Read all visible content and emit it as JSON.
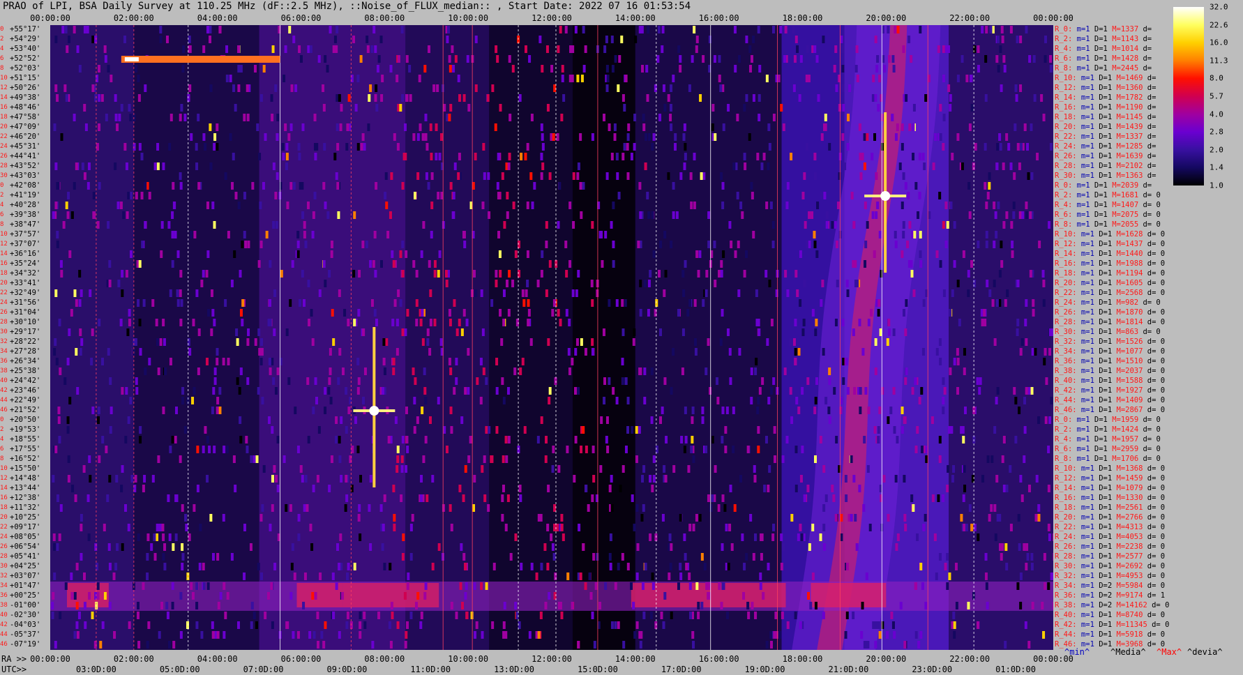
{
  "title": "PRAO of LPI, BSA Daily Survey at 110.25 MHz (dF::2.5 MHz), ::Noise_of_FLUX_median:: , Start Date: 2022 07 16 01:53:54",
  "chart_data": {
    "type": "heatmap",
    "title": "PRAO of LPI, BSA Daily Survey at 110.25 MHz (dF::2.5 MHz), ::Noise_of_FLUX_median:: , Start Date: 2022 07 16 01:53:54",
    "x_ra_ticks": [
      "00:00:00",
      "02:00:00",
      "04:00:00",
      "06:00:00",
      "08:00:00",
      "10:00:00",
      "12:00:00",
      "14:00:00",
      "16:00:00",
      "18:00:00",
      "20:00:00",
      "22:00:00",
      "00:00:00"
    ],
    "x_utc_ticks": [
      "03:0D:00",
      "05:0D:00",
      "07:0D:00",
      "09:0D:00",
      "11:0D:00",
      "13:0D:00",
      "15:0D:00",
      "17:0D:00",
      "19:0D:00",
      "21:0D:00",
      "23:0D:00",
      "01:0D:00"
    ],
    "dec_labels": [
      "+55°17'",
      "+54°29'",
      "+53°40'",
      "+52°52'",
      "+52°03'",
      "+51°15'",
      "+50°26'",
      "+49°38'",
      "+48°46'",
      "+47°58'",
      "+47°09'",
      "+46°20'",
      "+45°31'",
      "+44°41'",
      "+43°52'",
      "+43°03'",
      "+42°08'",
      "+41°19'",
      "+40°28'",
      "+39°38'",
      "+38°47'",
      "+37°57'",
      "+37°07'",
      "+36°16'",
      "+35°24'",
      "+34°32'",
      "+33°41'",
      "+32°49'",
      "+31°56'",
      "+31°04'",
      "+30°10'",
      "+29°17'",
      "+28°22'",
      "+27°28'",
      "+26°34'",
      "+25°38'",
      "+24°42'",
      "+23°46'",
      "+22°49'",
      "+21°52'",
      "+20°50'",
      "+19°53'",
      "+18°55'",
      "+17°55'",
      "+16°52'",
      "+15°50'",
      "+14°48'",
      "+13°44'",
      "+12°38'",
      "+11°32'",
      "+10°25'",
      "+09°17'",
      "+08°05'",
      "+06°54'",
      "+05°41'",
      "+04°25'",
      "+03°07'",
      "+01°47'",
      "+00°25'",
      "-01°00'",
      "-02°30'",
      "-04°03'",
      "-05°37'",
      "-07°19'"
    ],
    "row_numbers": [
      "0",
      "2",
      "4",
      "6",
      "8",
      "10",
      "12",
      "14",
      "16",
      "18",
      "20",
      "22",
      "24",
      "26",
      "28",
      "30",
      "0",
      "2",
      "4",
      "6",
      "8",
      "10",
      "12",
      "14",
      "16",
      "18",
      "20",
      "22",
      "24",
      "26",
      "28",
      "30",
      "32",
      "34",
      "36",
      "38",
      "40",
      "42",
      "44",
      "46",
      "0",
      "2",
      "4",
      "6",
      "8",
      "10",
      "12",
      "14",
      "16",
      "18",
      "20",
      "22",
      "24",
      "26",
      "28",
      "30",
      "32",
      "34",
      "36",
      "38",
      "40",
      "42",
      "44",
      "46"
    ],
    "row_stats": [
      {
        "r": "R_0:",
        "m": "1",
        "D": "1",
        "M": "1337",
        "d": ""
      },
      {
        "r": "R_2:",
        "m": "1",
        "D": "1",
        "M": "1143",
        "d": ""
      },
      {
        "r": "R_4:",
        "m": "1",
        "D": "1",
        "M": "1014",
        "d": ""
      },
      {
        "r": "R_6:",
        "m": "1",
        "D": "1",
        "M": "1428",
        "d": ""
      },
      {
        "r": "R_8:",
        "m": "1",
        "D": "1",
        "M": "2445",
        "d": ""
      },
      {
        "r": "R_10:",
        "m": "1",
        "D": "1",
        "M": "1469",
        "d": ""
      },
      {
        "r": "R_12:",
        "m": "1",
        "D": "1",
        "M": "1360",
        "d": ""
      },
      {
        "r": "R_14:",
        "m": "1",
        "D": "1",
        "M": "1782",
        "d": ""
      },
      {
        "r": "R_16:",
        "m": "1",
        "D": "1",
        "M": "1190",
        "d": ""
      },
      {
        "r": "R_18:",
        "m": "1",
        "D": "1",
        "M": "1145",
        "d": ""
      },
      {
        "r": "R_20:",
        "m": "1",
        "D": "1",
        "M": "1439",
        "d": ""
      },
      {
        "r": "R_22:",
        "m": "1",
        "D": "1",
        "M": "1337",
        "d": ""
      },
      {
        "r": "R_24:",
        "m": "1",
        "D": "1",
        "M": "1285",
        "d": ""
      },
      {
        "r": "R_26:",
        "m": "1",
        "D": "1",
        "M": "1639",
        "d": ""
      },
      {
        "r": "R_28:",
        "m": "1",
        "D": "1",
        "M": "2102",
        "d": ""
      },
      {
        "r": "R_30:",
        "m": "1",
        "D": "1",
        "M": "1363",
        "d": ""
      },
      {
        "r": "R_0:",
        "m": "1",
        "D": "1",
        "M": "2039",
        "d": ""
      },
      {
        "r": "R_2:",
        "m": "1",
        "D": "1",
        "M": "1681",
        "d": "0"
      },
      {
        "r": "R_4:",
        "m": "1",
        "D": "1",
        "M": "1407",
        "d": "0"
      },
      {
        "r": "R_6:",
        "m": "1",
        "D": "1",
        "M": "2075",
        "d": "0"
      },
      {
        "r": "R_8:",
        "m": "1",
        "D": "1",
        "M": "2055",
        "d": "0"
      },
      {
        "r": "R_10:",
        "m": "1",
        "D": "1",
        "M": "1628",
        "d": "0"
      },
      {
        "r": "R_12:",
        "m": "1",
        "D": "1",
        "M": "1437",
        "d": "0"
      },
      {
        "r": "R_14:",
        "m": "1",
        "D": "1",
        "M": "1440",
        "d": "0"
      },
      {
        "r": "R_16:",
        "m": "1",
        "D": "1",
        "M": "1988",
        "d": "0"
      },
      {
        "r": "R_18:",
        "m": "1",
        "D": "1",
        "M": "1194",
        "d": "0"
      },
      {
        "r": "R_20:",
        "m": "1",
        "D": "1",
        "M": "1605",
        "d": "0"
      },
      {
        "r": "R_22:",
        "m": "1",
        "D": "1",
        "M": "2568",
        "d": "0"
      },
      {
        "r": "R_24:",
        "m": "1",
        "D": "1",
        "M": "982",
        "d": "0"
      },
      {
        "r": "R_26:",
        "m": "1",
        "D": "1",
        "M": "1870",
        "d": "0"
      },
      {
        "r": "R_28:",
        "m": "1",
        "D": "1",
        "M": "1814",
        "d": "0"
      },
      {
        "r": "R_30:",
        "m": "1",
        "D": "1",
        "M": "863",
        "d": "0"
      },
      {
        "r": "R_32:",
        "m": "1",
        "D": "1",
        "M": "1526",
        "d": "0"
      },
      {
        "r": "R_34:",
        "m": "1",
        "D": "1",
        "M": "1077",
        "d": "0"
      },
      {
        "r": "R_36:",
        "m": "1",
        "D": "1",
        "M": "1510",
        "d": "0"
      },
      {
        "r": "R_38:",
        "m": "1",
        "D": "1",
        "M": "2037",
        "d": "0"
      },
      {
        "r": "R_40:",
        "m": "1",
        "D": "1",
        "M": "1588",
        "d": "0"
      },
      {
        "r": "R_42:",
        "m": "1",
        "D": "1",
        "M": "1927",
        "d": "0"
      },
      {
        "r": "R_44:",
        "m": "1",
        "D": "1",
        "M": "1409",
        "d": "0"
      },
      {
        "r": "R_46:",
        "m": "1",
        "D": "1",
        "M": "2867",
        "d": "0"
      },
      {
        "r": "R_0:",
        "m": "1",
        "D": "1",
        "M": "1959",
        "d": "0"
      },
      {
        "r": "R_2:",
        "m": "1",
        "D": "1",
        "M": "1424",
        "d": "0"
      },
      {
        "r": "R_4:",
        "m": "1",
        "D": "1",
        "M": "1957",
        "d": "0"
      },
      {
        "r": "R_6:",
        "m": "1",
        "D": "1",
        "M": "2959",
        "d": "0"
      },
      {
        "r": "R_8:",
        "m": "1",
        "D": "1",
        "M": "1706",
        "d": "0"
      },
      {
        "r": "R_10:",
        "m": "1",
        "D": "1",
        "M": "1368",
        "d": "0"
      },
      {
        "r": "R_12:",
        "m": "1",
        "D": "1",
        "M": "1459",
        "d": "0"
      },
      {
        "r": "R_14:",
        "m": "1",
        "D": "1",
        "M": "1079",
        "d": "0"
      },
      {
        "r": "R_16:",
        "m": "1",
        "D": "1",
        "M": "1330",
        "d": "0"
      },
      {
        "r": "R_18:",
        "m": "1",
        "D": "1",
        "M": "2561",
        "d": "0"
      },
      {
        "r": "R_20:",
        "m": "1",
        "D": "1",
        "M": "2766",
        "d": "0"
      },
      {
        "r": "R_22:",
        "m": "1",
        "D": "1",
        "M": "4313",
        "d": "0"
      },
      {
        "r": "R_24:",
        "m": "1",
        "D": "1",
        "M": "4053",
        "d": "0"
      },
      {
        "r": "R_26:",
        "m": "1",
        "D": "1",
        "M": "2238",
        "d": "0"
      },
      {
        "r": "R_28:",
        "m": "1",
        "D": "1",
        "M": "2577",
        "d": "0"
      },
      {
        "r": "R_30:",
        "m": "1",
        "D": "1",
        "M": "2692",
        "d": "0"
      },
      {
        "r": "R_32:",
        "m": "1",
        "D": "1",
        "M": "4953",
        "d": "0"
      },
      {
        "r": "R_34:",
        "m": "1",
        "D": "2",
        "M": "5984",
        "d": "0"
      },
      {
        "r": "R_36:",
        "m": "1",
        "D": "2",
        "M": "9174",
        "d": "1"
      },
      {
        "r": "R_38:",
        "m": "1",
        "D": "2",
        "M": "14162",
        "d": "0"
      },
      {
        "r": "R_40:",
        "m": "1",
        "D": "1",
        "M": "8740",
        "d": "0"
      },
      {
        "r": "R_42:",
        "m": "1",
        "D": "1",
        "M": "11345",
        "d": "0"
      },
      {
        "r": "R_44:",
        "m": "1",
        "D": "1",
        "M": "5918",
        "d": "0"
      },
      {
        "r": "R_46:",
        "m": "1",
        "D": "1",
        "M": "3968",
        "d": "0"
      }
    ],
    "colorbar": {
      "tick_labels": [
        "32.0",
        "22.6",
        "16.0",
        "11.3",
        "8.0",
        "5.7",
        "4.0",
        "2.8",
        "2.0",
        "1.4",
        "1.0"
      ],
      "colors": [
        "#ffffff",
        "#ffff60",
        "#ffd000",
        "#ff8000",
        "#ff1000",
        "#d00050",
        "#a000a0",
        "#6a00d0",
        "#3810a0",
        "#140860",
        "#000000"
      ]
    },
    "features": [
      {
        "type": "cross",
        "ra_hours": 7.75,
        "dec": "+21°52'"
      },
      {
        "type": "cross",
        "ra_hours": 19.98,
        "dec": "+41°19'"
      },
      {
        "type": "streak",
        "ra_hours": [
          1.7,
          5.5
        ],
        "dec": "+52°52'"
      }
    ]
  },
  "footer": {
    "ra_prefix": "RA >>",
    "utc_prefix": "UTC>>",
    "legend": {
      "min": "^min^",
      "median": "^Media^",
      "max": "^Max^",
      "devia": "^devia^"
    }
  },
  "colors": {
    "label_red": "#ff1818",
    "text_blue": "#0000b0",
    "background": "#bdbdbd",
    "max_red": "#ff0000",
    "min_blue": "#0000c0"
  }
}
